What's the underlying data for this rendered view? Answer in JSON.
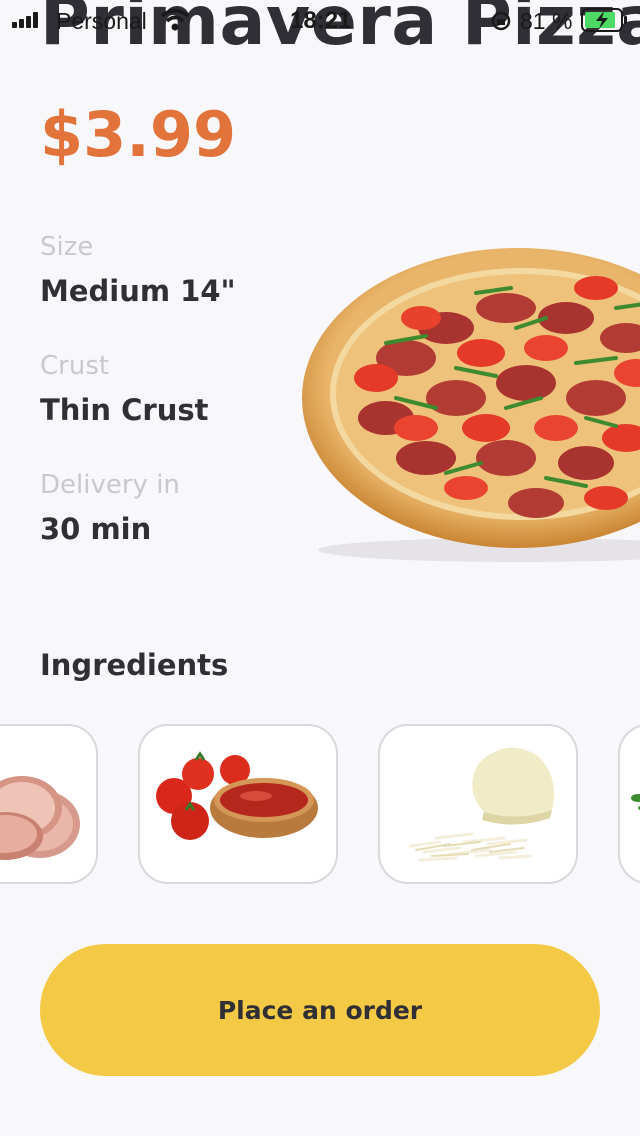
{
  "status_bar": {
    "carrier": "Personal",
    "time": "18:21",
    "battery_percent": "81 %"
  },
  "product": {
    "title": "Primavera Pizza",
    "price": "$3.99"
  },
  "details": [
    {
      "label": "Size",
      "value": "Medium 14\""
    },
    {
      "label": "Crust",
      "value": "Thin Crust"
    },
    {
      "label": "Delivery in",
      "value": "30 min"
    }
  ],
  "ingredients": {
    "title": "Ingredients",
    "items": [
      {
        "icon": "ham-icon"
      },
      {
        "icon": "tomato-sauce-icon"
      },
      {
        "icon": "cheese-icon"
      },
      {
        "icon": "herbs-icon"
      }
    ]
  },
  "actions": {
    "order_label": "Place an order"
  },
  "colors": {
    "accent": "#e1733b",
    "button": "#f4c945",
    "background": "#f8f7fa",
    "text": "#2f2f35",
    "muted": "#c9c8cd"
  }
}
